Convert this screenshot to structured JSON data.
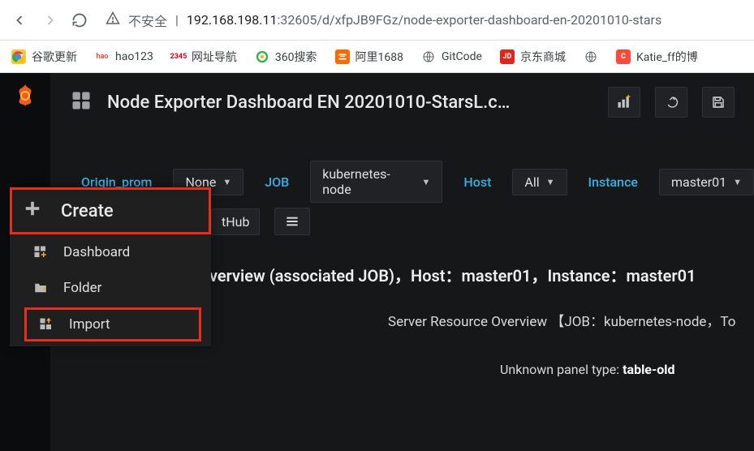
{
  "browser": {
    "insecure_label": "不安全",
    "url_host": "192.168.198.11",
    "url_port_path": ":32605/d/xfpJB9FGz/node-exporter-dashboard-en-20201010-stars"
  },
  "bookmarks": [
    {
      "label": "谷歌更新",
      "icon_bg": "#f9c440",
      "icon_txt": "",
      "icon_type": "chrome"
    },
    {
      "label": "hao123",
      "icon_bg": "#fff",
      "icon_txt": "hao",
      "icon_type": "text",
      "txt_color": "#e84c3d"
    },
    {
      "label": "网址导航",
      "icon_bg": "#fff",
      "icon_txt": "2345",
      "icon_type": "text",
      "txt_color": "#d0021b"
    },
    {
      "label": "360搜索",
      "icon_bg": "#fff",
      "icon_txt": "",
      "icon_type": "360"
    },
    {
      "label": "阿里1688",
      "icon_bg": "#ff6a00",
      "icon_txt": "",
      "icon_type": "ali"
    },
    {
      "label": "GitCode",
      "icon_bg": "#fff",
      "icon_txt": "",
      "icon_type": "globe"
    },
    {
      "label": "京东商城",
      "icon_bg": "#e1251b",
      "icon_txt": "JD",
      "icon_type": "text",
      "txt_color": "#fff"
    },
    {
      "label": "",
      "icon_bg": "#fff",
      "icon_txt": "",
      "icon_type": "globe"
    },
    {
      "label": "Katie_ff的博",
      "icon_bg": "#ff4a3b",
      "icon_txt": "C",
      "icon_type": "text",
      "txt_color": "#fff"
    }
  ],
  "header": {
    "title": "Node Exporter Dashboard EN 20201010-StarsL.c…"
  },
  "variables": {
    "origin": {
      "label": "Origin_prom",
      "value": "None"
    },
    "job": {
      "label": "JOB",
      "value": "kubernetes-node"
    },
    "host": {
      "label": "Host",
      "value": "All"
    },
    "instance": {
      "label": "Instance",
      "value": "master01"
    }
  },
  "row2": {
    "thub": "tHub"
  },
  "sidebar_flyout": {
    "header": "Create",
    "items": [
      {
        "label": "Dashboard",
        "icon": "panel-plus"
      },
      {
        "label": "Folder",
        "icon": "folder-plus"
      },
      {
        "label": "Import",
        "icon": "import"
      }
    ]
  },
  "content": {
    "line1_a": "verview (associated JOB)，Host：",
    "line1_b": "master01",
    "line1_c": "，Instance：",
    "line1_d": "master01",
    "line2": "Server Resource Overview 【JOB：kubernetes-node，To",
    "line3_a": "Unknown panel type: ",
    "line3_b": "table-old"
  }
}
